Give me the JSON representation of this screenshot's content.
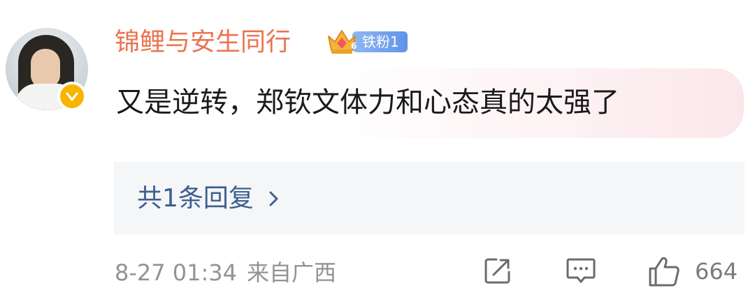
{
  "comment": {
    "username": "锦鲤与安生同行",
    "fan_badge": {
      "level_icon_text": "6",
      "label": "铁粉1"
    },
    "verified_icon": "verified-v-icon",
    "text": "又是逆转，郑钦文体力和心态真的太强了",
    "replies_label": "共1条回复",
    "date": "8-27 01:34",
    "location": "来自广西",
    "like_count": "664"
  },
  "icons": {
    "share": "share-icon",
    "reply": "comment-icon",
    "like": "thumbs-up-icon",
    "chevron": "chevron-right-icon",
    "crown": "crown-icon"
  },
  "colors": {
    "username": "#eb7350",
    "reply_link": "#3e5f90",
    "meta": "#939393",
    "verified": "#f7b500",
    "fan_pill": "#6f9eec"
  }
}
